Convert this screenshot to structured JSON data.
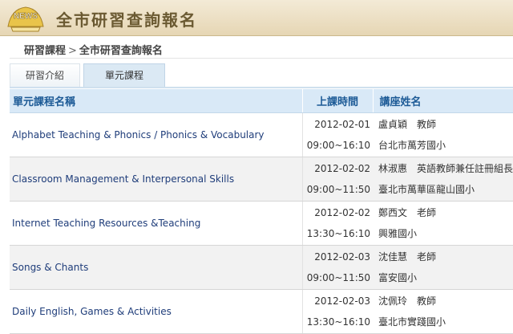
{
  "header": {
    "logo_text": "NEWS",
    "site_title": "全市研習查詢報名"
  },
  "breadcrumb": {
    "parent": "研習課程",
    "separator": ">",
    "current": "全市研習查詢報名"
  },
  "tabs": [
    {
      "label": "研習介紹",
      "active": false
    },
    {
      "label": "單元課程",
      "active": true
    }
  ],
  "table": {
    "headers": {
      "name": "單元課程名稱",
      "time": "上課時間",
      "lecturer": "講座姓名"
    },
    "rows": [
      {
        "name": "Alphabet Teaching & Phonics / Phonics & Vocabulary",
        "date": "2012-02-01",
        "hours": "09:00~16:10",
        "lecturer": "盧貞穎　教師",
        "school": "台北市萬芳國小"
      },
      {
        "name": "Classroom Management & Interpersonal Skills",
        "date": "2012-02-02",
        "hours": "09:00~11:50",
        "lecturer": "林淑惠　英語教師兼任註冊組長",
        "school": "臺北市萬華區龍山國小"
      },
      {
        "name": "Internet Teaching Resources &Teaching",
        "date": "2012-02-02",
        "hours": "13:30~16:10",
        "lecturer": "鄭西文　老師",
        "school": "興雅國小"
      },
      {
        "name": "Songs & Chants",
        "date": "2012-02-03",
        "hours": "09:00~11:50",
        "lecturer": "沈佳慧　老師",
        "school": "富安國小"
      },
      {
        "name": "Daily English, Games & Activities",
        "date": "2012-02-03",
        "hours": "13:30~16:10",
        "lecturer": "沈佩玲　教師",
        "school": "臺北市實踐國小"
      }
    ]
  }
}
